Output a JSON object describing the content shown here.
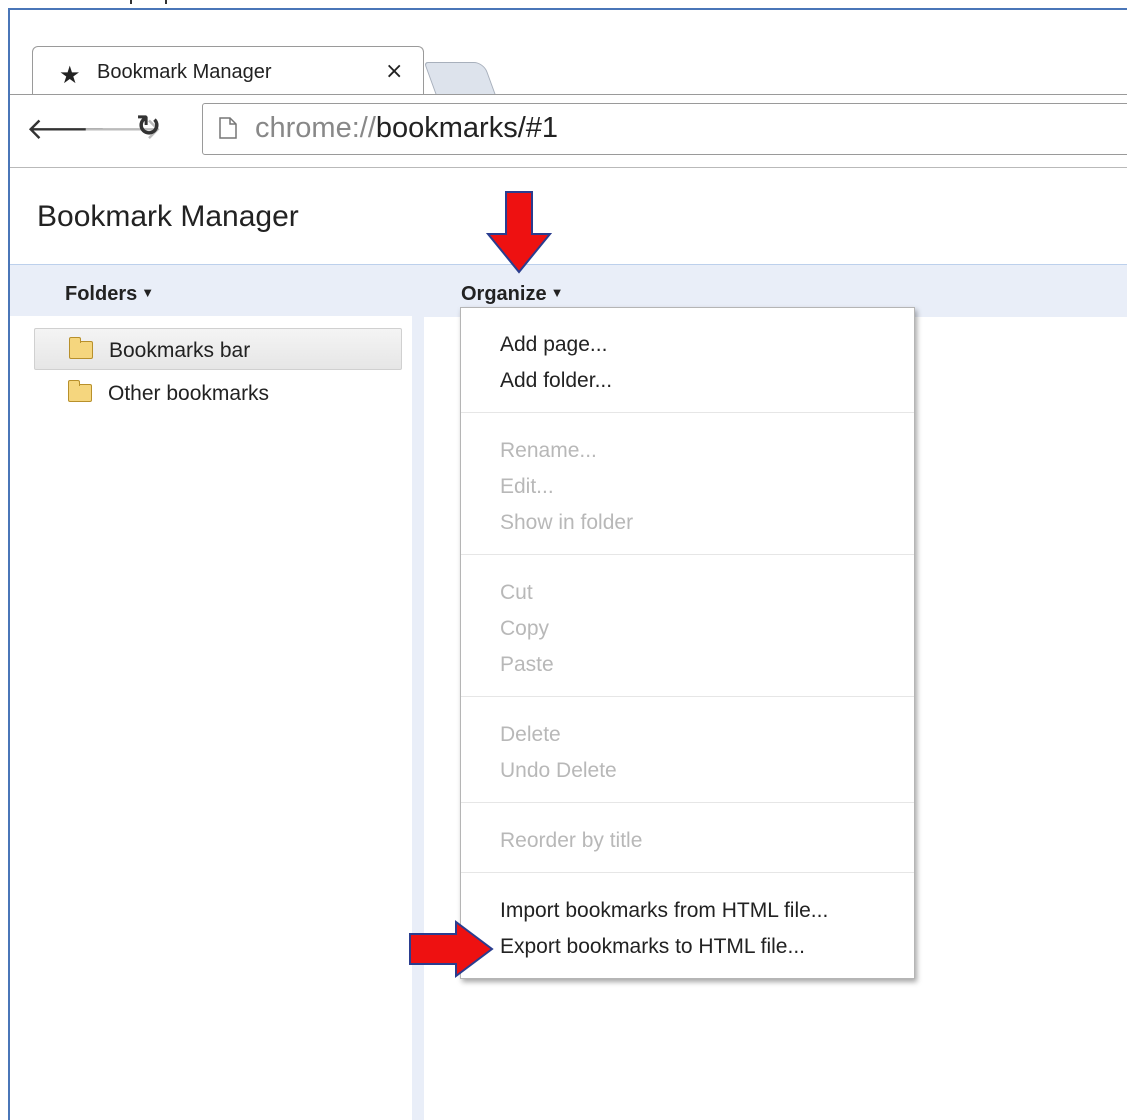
{
  "browser": {
    "tab_title": "Bookmark Manager",
    "tab_close": "×",
    "url_scheme": "chrome://",
    "url_host": "bookmarks",
    "url_path": "/#1",
    "icons": {
      "tab": "star-icon",
      "back": "back-arrow-icon",
      "forward": "forward-arrow-icon",
      "reload": "reload-icon",
      "page": "page-icon",
      "close": "close-icon"
    }
  },
  "page": {
    "title": "Bookmark Manager",
    "folders_menu": "Folders",
    "organize_menu": "Organize"
  },
  "folders": [
    {
      "label": "Bookmarks bar",
      "selected": true
    },
    {
      "label": "Other bookmarks",
      "selected": false
    }
  ],
  "organize_menu": {
    "groups": [
      [
        {
          "label": "Add page...",
          "enabled": true
        },
        {
          "label": "Add folder...",
          "enabled": true
        }
      ],
      [
        {
          "label": "Rename...",
          "enabled": false
        },
        {
          "label": "Edit...",
          "enabled": false
        },
        {
          "label": "Show in folder",
          "enabled": false
        }
      ],
      [
        {
          "label": "Cut",
          "enabled": false
        },
        {
          "label": "Copy",
          "enabled": false
        },
        {
          "label": "Paste",
          "enabled": false
        }
      ],
      [
        {
          "label": "Delete",
          "enabled": false
        },
        {
          "label": "Undo Delete",
          "enabled": false
        }
      ],
      [
        {
          "label": "Reorder by title",
          "enabled": false
        }
      ],
      [
        {
          "label": "Import bookmarks from HTML file...",
          "enabled": true
        },
        {
          "label": "Export bookmarks to HTML file...",
          "enabled": true
        }
      ]
    ]
  },
  "annotations": {
    "arrow_color": "#ee1111",
    "arrow_icon": "red-arrow-icon"
  }
}
